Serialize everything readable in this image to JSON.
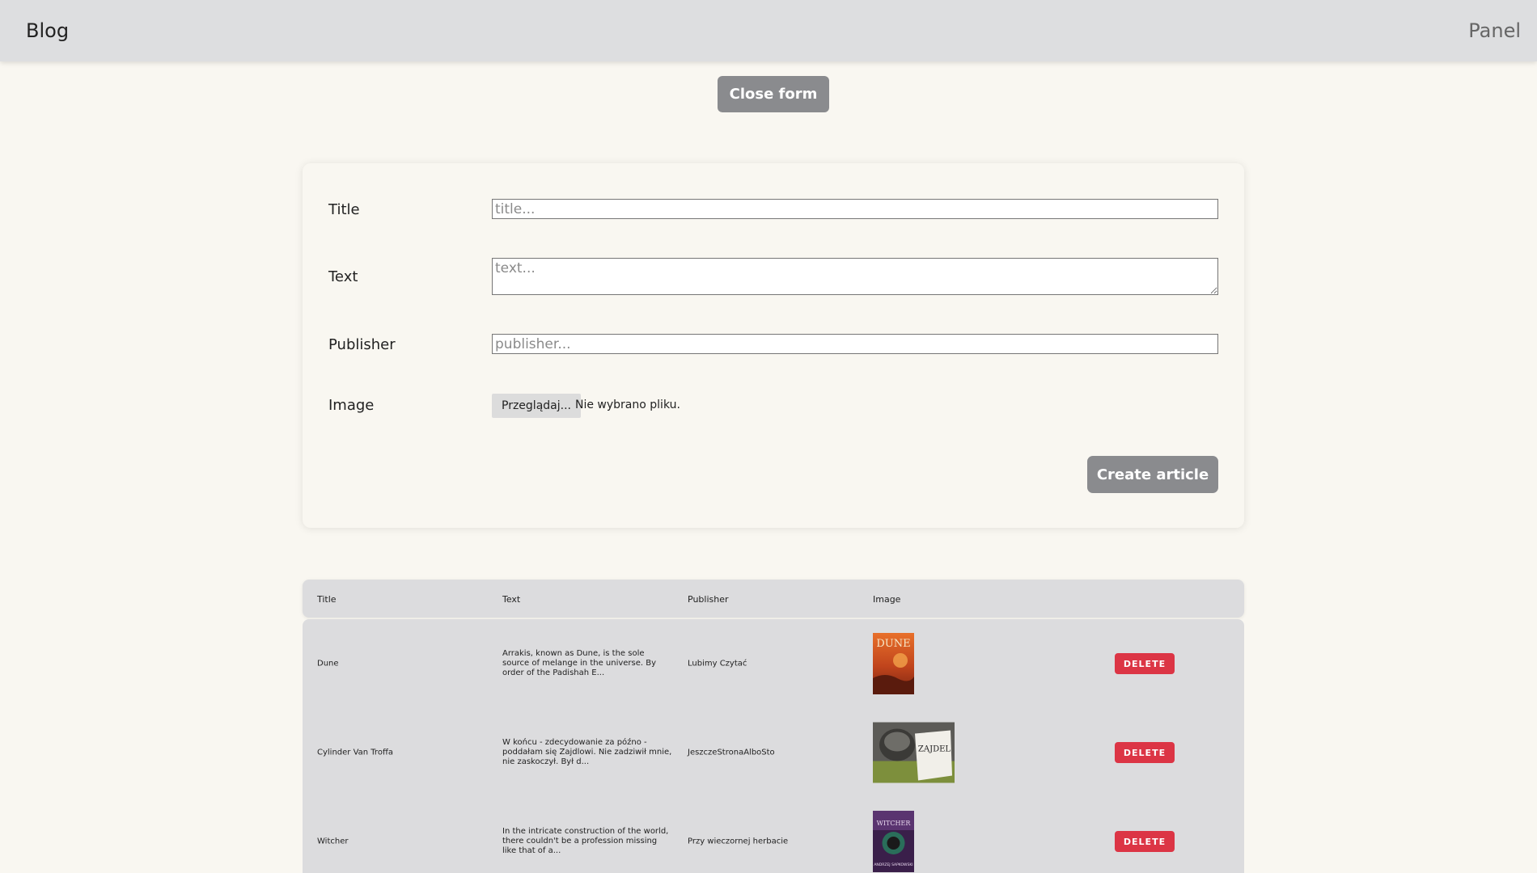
{
  "header": {
    "brand": "Blog",
    "panel_link": "Panel"
  },
  "close_form_label": "Close form",
  "form": {
    "title_label": "Title",
    "title_placeholder": "title...",
    "text_label": "Text",
    "text_placeholder": "text...",
    "publisher_label": "Publisher",
    "publisher_placeholder": "publisher...",
    "image_label": "Image",
    "file_button_label": "Przeglądaj...",
    "file_status": "Nie wybrano pliku.",
    "create_label": "Create article"
  },
  "table": {
    "headers": [
      "Title",
      "Text",
      "Publisher",
      "Image"
    ],
    "rows": [
      {
        "title": "Dune",
        "text": "Arrakis, known as Dune, is the sole source of melange in the universe. By order of the Padishah E...",
        "publisher": "Lubimy Czytać",
        "image_label": "DUNE",
        "delete_label": "DELETE"
      },
      {
        "title": "Cylinder Van Troffa",
        "text": "W końcu - zdecydowanie za późno - poddałam się Zajdlowi. Nie zadziwił mnie, nie zaskoczył. Był d...",
        "publisher": "JeszczeStronaAlboSto",
        "image_label": "ZAJDEL",
        "delete_label": "DELETE"
      },
      {
        "title": "Witcher",
        "text": "In the intricate construction of the world, there couldn't be a profession missing like that of a...",
        "publisher": "Przy wieczornej herbacie",
        "image_label": "WITCHER",
        "image_author": "ANDRZEJ SAPKOWSKI",
        "delete_label": "DELETE"
      }
    ]
  },
  "colors": {
    "page_bg": "#f9f7f1",
    "header_bg": "#dddee0",
    "button_gray": "#8a8b8e",
    "table_bg": "#dcdcde",
    "delete_red": "#dc3545"
  }
}
